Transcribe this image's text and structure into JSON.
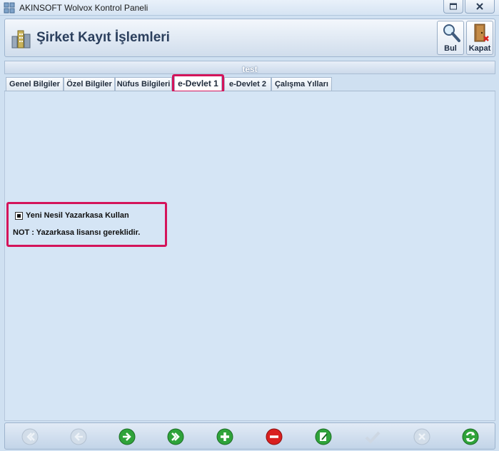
{
  "window": {
    "title": "AKINSOFT Wolvox Kontrol Paneli"
  },
  "header": {
    "title": "Şirket Kayıt İşlemleri",
    "buttons": {
      "find": "Bul",
      "close": "Kapat"
    }
  },
  "record": {
    "name": "test"
  },
  "tabs": [
    {
      "label": "Genel Bilgiler",
      "active": false
    },
    {
      "label": "Özel Bilgiler",
      "active": false
    },
    {
      "label": "Nüfus Bilgileri",
      "active": false
    },
    {
      "label": "e-Devlet 1",
      "active": true
    },
    {
      "label": "e-Devlet 2",
      "active": false
    },
    {
      "label": "Çalışma Yılları",
      "active": false
    }
  ],
  "content": {
    "checkbox_label": "Yeni Nesil Yazarkasa Kullan",
    "checkbox_checked": true,
    "note": "NOT : Yazarkasa lisansı gereklidir."
  },
  "colors": {
    "highlight": "#d4145a",
    "green": "#2fa33a",
    "red": "#d9201f"
  },
  "navbar": {
    "buttons": [
      {
        "name": "first-record",
        "enabled": false
      },
      {
        "name": "previous-record",
        "enabled": false
      },
      {
        "name": "next-record",
        "enabled": true
      },
      {
        "name": "last-record",
        "enabled": true
      },
      {
        "name": "add-record",
        "enabled": true
      },
      {
        "name": "delete-record",
        "enabled": true
      },
      {
        "name": "edit-record",
        "enabled": true
      },
      {
        "name": "save-record",
        "enabled": false
      },
      {
        "name": "cancel-edit",
        "enabled": false
      },
      {
        "name": "refresh-records",
        "enabled": true
      }
    ]
  }
}
